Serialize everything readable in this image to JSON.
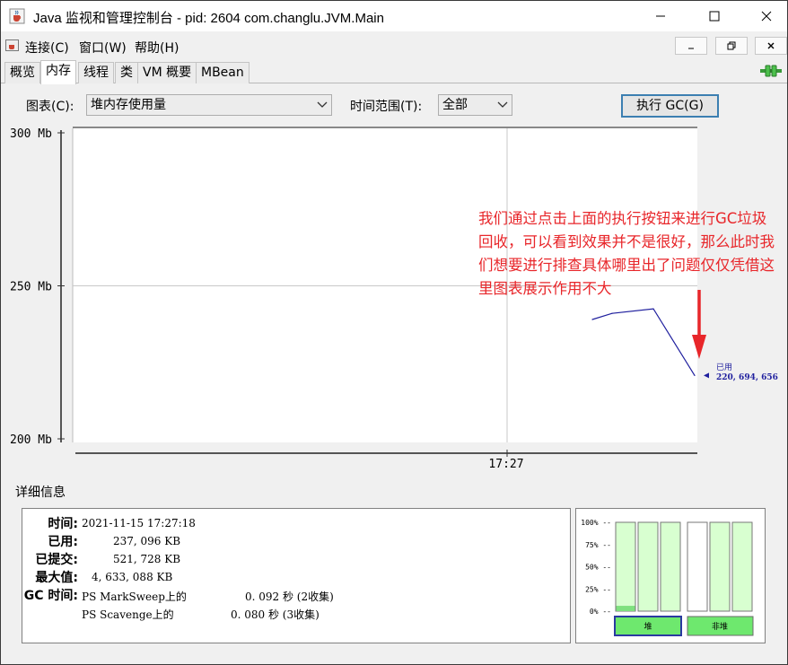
{
  "window": {
    "title": "Java 监视和管理控制台 - pid: 2604 com.changlu.JVM.Main"
  },
  "menu": {
    "items": [
      "连接(C)",
      "窗口(W)",
      "帮助(H)"
    ]
  },
  "tabs": [
    "概览",
    "内存",
    "线程",
    "类",
    "VM 概要",
    "MBean"
  ],
  "active_tab": "内存",
  "toolbar": {
    "chart_label": "图表(C):",
    "chart_value": "堆内存使用量",
    "range_label": "时间范围(T):",
    "range_value": "全部",
    "gc_button": "执行 GC(G)"
  },
  "chart_data": {
    "type": "line",
    "y_ticks": [
      "300 Mb",
      "250 Mb",
      "200 Mb"
    ],
    "ylim": [
      200,
      300
    ],
    "x_tick": "17:27",
    "series": [
      {
        "name": "已用",
        "values": [
          239,
          241,
          242.5,
          220.7
        ]
      }
    ],
    "current_value_label": "220, 694, 656",
    "grid": true,
    "line_color": "#1f1f9e"
  },
  "annotation": {
    "text": "我们通过点击上面的执行按钮来进行GC垃圾回收，可以看到效果并不是很好，那么此时我们想要进行排查具体哪里出了问题仅仅凭借这里图表展示作用不大",
    "color": "#e8262a"
  },
  "details": {
    "title": "详细信息",
    "time_key": "时间:",
    "time_val": "2021-11-15 17:27:18",
    "used_key": "已用:",
    "used_val": "237, 096 KB",
    "committed_key": "已提交:",
    "committed_val": "521, 728 KB",
    "max_key": "最大值:",
    "max_val": "4, 633, 088 KB",
    "gc_key": "GC 时间:",
    "gc1_name": "PS MarkSweep上的",
    "gc1_val": "0. 092 秒 (2收集)",
    "gc2_name": "PS Scavenge上的",
    "gc2_val": "0. 080 秒 (3收集)"
  },
  "pools": {
    "y_ticks": [
      "100% --",
      "75% --",
      "50% --",
      "25% --",
      "0% --"
    ],
    "heap_label": "堆",
    "nonheap_label": "非堆",
    "heap_levels": [
      0.06,
      0.0,
      0.0
    ],
    "nonheap_levels": [
      0.0,
      0.0,
      0.0
    ],
    "fill_color": "#7fe07f",
    "bar_color": "#d8ffd0"
  }
}
